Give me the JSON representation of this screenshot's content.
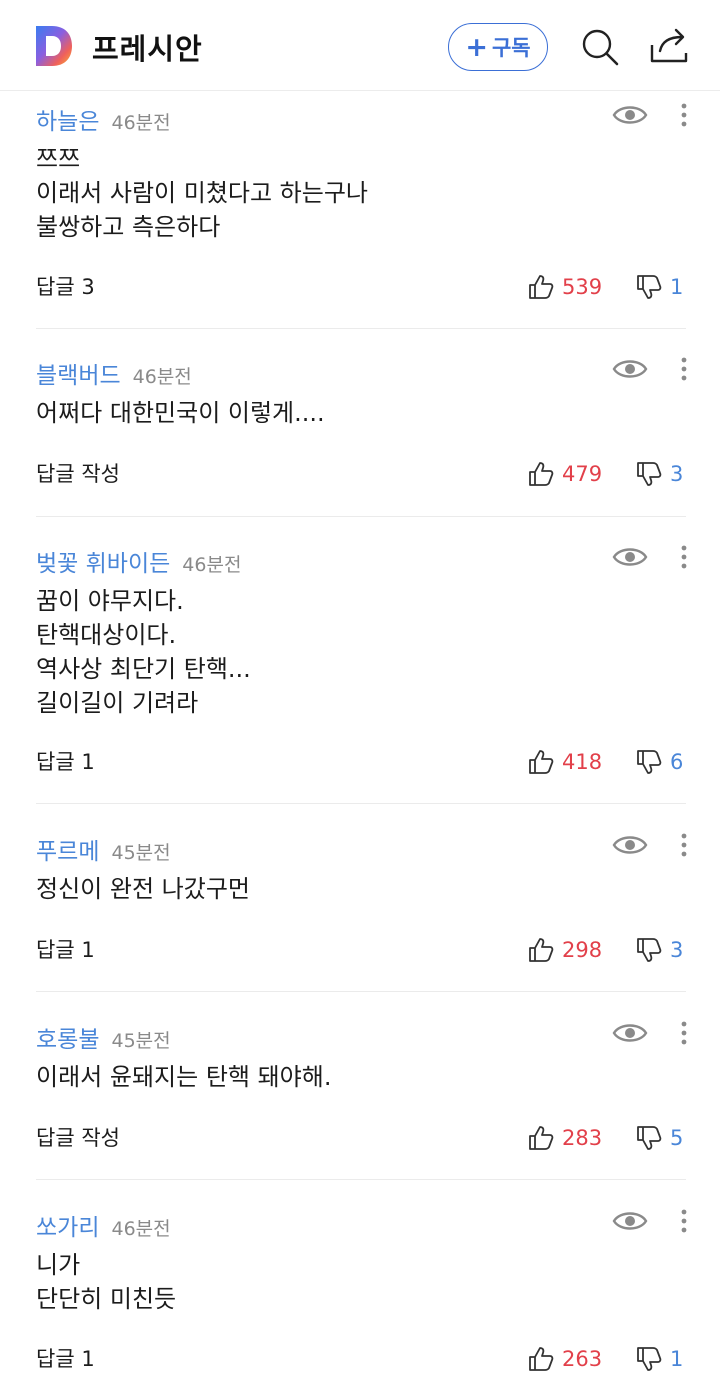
{
  "header": {
    "brand": "프레시안",
    "subscribe_plus": "+",
    "subscribe_label": "구독",
    "icons": {
      "logo": "daum-logo",
      "search": "search-icon",
      "share": "share-icon"
    },
    "accent": "#3b6fd6"
  },
  "colors": {
    "author": "#4a86d8",
    "like": "#e2404a",
    "dislike": "#4a86d8"
  },
  "comments": [
    {
      "author": "하늘은",
      "time": "46분전",
      "lines": [
        "쯔쯔",
        "이래서 사람이 미쳤다고 하는구나",
        "불쌍하고 측은하다"
      ],
      "reply": "답글 3",
      "likes": "539",
      "dislikes": "1"
    },
    {
      "author": "블랙버드",
      "time": "46분전",
      "lines": [
        "어쩌다 대한민국이 이렇게...."
      ],
      "reply": "답글 작성",
      "likes": "479",
      "dislikes": "3"
    },
    {
      "author": "벚꽃 휘바이든",
      "time": "46분전",
      "lines": [
        "꿈이 야무지다.",
        "탄핵대상이다.",
        "역사상 최단기 탄핵...",
        "길이길이 기려라"
      ],
      "reply": "답글 1",
      "likes": "418",
      "dislikes": "6"
    },
    {
      "author": "푸르메",
      "time": "45분전",
      "lines": [
        "정신이 완전 나갔구먼"
      ],
      "reply": "답글 1",
      "likes": "298",
      "dislikes": "3"
    },
    {
      "author": "호롱불",
      "time": "45분전",
      "lines": [
        "이래서 윤돼지는 탄핵 돼야해."
      ],
      "reply": "답글 작성",
      "likes": "283",
      "dislikes": "5"
    },
    {
      "author": "쏘가리",
      "time": "46분전",
      "lines": [
        "니가",
        "단단히 미친듯"
      ],
      "reply": "답글 1",
      "likes": "263",
      "dislikes": "1"
    }
  ]
}
